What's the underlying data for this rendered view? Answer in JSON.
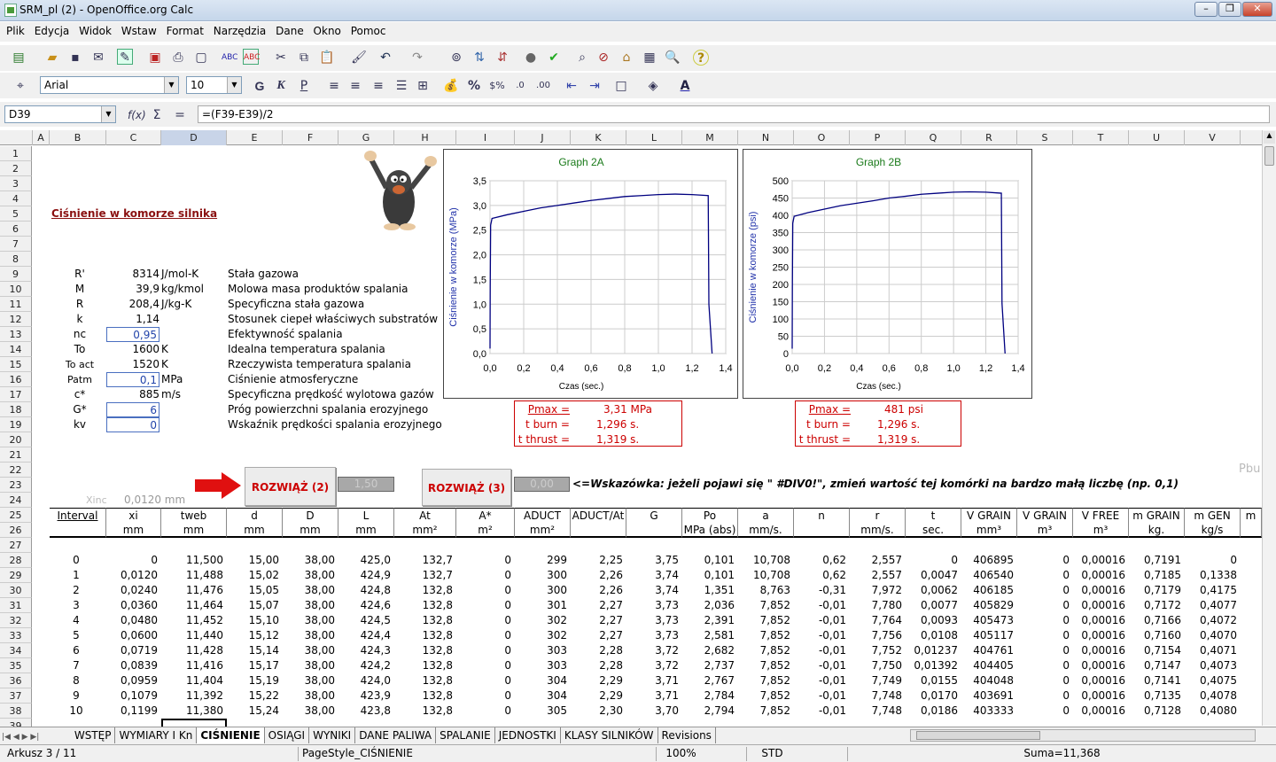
{
  "window": {
    "title": "SRM_pl (2) - OpenOffice.org Calc"
  },
  "menu": [
    "Plik",
    "Edycja",
    "Widok",
    "Wstaw",
    "Format",
    "Narzędzia",
    "Dane",
    "Okno",
    "Pomoc"
  ],
  "font": {
    "name": "Arial",
    "size": "10"
  },
  "formula": {
    "cell_ref": "D39",
    "content": "=(F39-E39)/2"
  },
  "columns": [
    "A",
    "B",
    "C",
    "D",
    "E",
    "F",
    "G",
    "H",
    "I",
    "J",
    "K",
    "L",
    "M",
    "N",
    "O",
    "P",
    "Q",
    "R",
    "S",
    "T",
    "U",
    "V"
  ],
  "rows": [
    "1",
    "2",
    "3",
    "4",
    "5",
    "6",
    "7",
    "8",
    "9",
    "10",
    "11",
    "12",
    "13",
    "14",
    "15",
    "16",
    "17",
    "18",
    "19",
    "20",
    "21",
    "22",
    "23",
    "24",
    "25",
    "26",
    "27",
    "28",
    "29",
    "30",
    "31",
    "32",
    "33",
    "34",
    "35",
    "36",
    "37",
    "38",
    "39"
  ],
  "sheet_title": "Ciśnienie w komorze silnika",
  "params": [
    {
      "sym": "R'",
      "val": "8314",
      "unit": "J/mol-K",
      "desc": "Stała gazowa"
    },
    {
      "sym": "M",
      "val": "39,9",
      "unit": "kg/kmol",
      "desc": "Molowa masa produktów spalania"
    },
    {
      "sym": "R",
      "val": "208,4",
      "unit": "J/kg-K",
      "desc": "Specyficzna stała gazowa"
    },
    {
      "sym": "k",
      "val": "1,14",
      "unit": "",
      "desc": "Stosunek ciepeł właściwych substratów"
    },
    {
      "sym": "nc",
      "val": "0,95",
      "unit": "",
      "desc": "Efektywność spalania"
    },
    {
      "sym": "To",
      "val": "1600",
      "unit": "K",
      "desc": "Idealna temperatura spalania"
    },
    {
      "sym": "To act",
      "val": "1520",
      "unit": "K",
      "desc": "Rzeczywista temperatura spalania"
    },
    {
      "sym": "Patm",
      "val": "0,1",
      "unit": "MPa",
      "desc": "Ciśnienie atmosferyczne"
    },
    {
      "sym": "c*",
      "val": "885",
      "unit": "m/s",
      "desc": "Specyficzna prędkość wylotowa gazów"
    },
    {
      "sym": "G*",
      "val": "6",
      "unit": "",
      "desc": "Próg powierzchni spalania erozyjnego"
    },
    {
      "sym": "kv",
      "val": "0",
      "unit": "",
      "desc": "Wskaźnik prędkości spalania erozyjnego"
    }
  ],
  "graph2a": {
    "title": "Graph 2A",
    "ylabel": "Ciśnienie w komorze (MPa)",
    "xlabel": "Czas (sec.)",
    "yticks": [
      "3,5",
      "3,0",
      "2,5",
      "2,0",
      "1,5",
      "1,0",
      "0,5",
      "0,0"
    ],
    "xticks": [
      "0,0",
      "0,2",
      "0,4",
      "0,6",
      "0,8",
      "1,0",
      "1,2",
      "1,4"
    ]
  },
  "graph2b": {
    "title": "Graph 2B",
    "ylabel": "Ciśnienie w komorze (psi)",
    "xlabel": "Czas (sec.)",
    "yticks": [
      "500",
      "450",
      "400",
      "350",
      "300",
      "250",
      "200",
      "150",
      "100",
      "50",
      "0"
    ],
    "xticks": [
      "0,0",
      "0,2",
      "0,4",
      "0,6",
      "0,8",
      "1,0",
      "1,2",
      "1,4"
    ]
  },
  "chart_data": [
    {
      "type": "line",
      "title": "Graph 2A",
      "xlabel": "Czas (sec.)",
      "ylabel": "Ciśnienie w komorze (MPa)",
      "xlim": [
        0,
        1.4
      ],
      "ylim": [
        0,
        3.5
      ],
      "x": [
        0,
        0.0012,
        0.0036,
        0.012,
        0.1,
        0.2,
        0.3,
        0.4,
        0.5,
        0.6,
        0.7,
        0.8,
        0.9,
        1.0,
        1.1,
        1.2,
        1.296,
        1.3,
        1.319
      ],
      "y": [
        0.101,
        1.351,
        2.6,
        2.737,
        2.81,
        2.88,
        2.95,
        3.0,
        3.05,
        3.1,
        3.14,
        3.18,
        3.2,
        3.22,
        3.23,
        3.22,
        3.2,
        1.0,
        0.0
      ]
    },
    {
      "type": "line",
      "title": "Graph 2B",
      "xlabel": "Czas (sec.)",
      "ylabel": "Ciśnienie w komorze (psi)",
      "xlim": [
        0,
        1.4
      ],
      "ylim": [
        0,
        500
      ],
      "x": [
        0,
        0.0012,
        0.0036,
        0.012,
        0.1,
        0.2,
        0.3,
        0.4,
        0.5,
        0.6,
        0.7,
        0.8,
        0.9,
        1.0,
        1.1,
        1.2,
        1.296,
        1.3,
        1.319
      ],
      "y": [
        14,
        196,
        377,
        397,
        408,
        418,
        428,
        435,
        442,
        450,
        455,
        461,
        464,
        467,
        468,
        467,
        464,
        145,
        0
      ]
    }
  ],
  "summary_a": {
    "p_lbl": "Pmax =",
    "p_val": "3,31 MPa",
    "tb_lbl": "t burn =",
    "tb_val": "1,296 s.",
    "tt_lbl": "t thrust =",
    "tt_val": "1,319 s."
  },
  "summary_b": {
    "p_lbl": "Pmax =",
    "p_val": "481 psi",
    "tb_lbl": "t burn =",
    "tb_val": "1,296 s.",
    "tt_lbl": "t thrust =",
    "tt_val": "1,319 s."
  },
  "solve2": {
    "label": "ROZWIĄŻ (2)",
    "box": "1,50"
  },
  "solve3": {
    "label": "ROZWIĄŻ (3)",
    "box": "0,00"
  },
  "hint": "<=Wskazówka: jeżeli pojawi się \" #DIV0!\", zmień wartość tej komórki na bardzo małą liczbę (np. 0,1)",
  "xinc": {
    "lbl": "Xinc",
    "val": "0,0120 mm"
  },
  "pbu": "Pbu",
  "table_headers": [
    "Interval",
    "xi",
    "tweb",
    "d",
    "D",
    "L",
    "At",
    "A*",
    "ADUCT",
    "ADUCT/At",
    "G",
    "Po",
    "a",
    "n",
    "r",
    "t",
    "V GRAIN",
    "V GRAIN",
    "V FREE",
    "m GRAIN",
    "m GEN",
    "m"
  ],
  "table_units": [
    "",
    "mm",
    "mm",
    "mm",
    "mm",
    "mm",
    "mm²",
    "m²",
    "mm²",
    "",
    "",
    "MPa (abs)",
    "mm/s.",
    "",
    "mm/s.",
    "sec.",
    "mm³",
    "m³",
    "m³",
    "kg.",
    "kg/s",
    ""
  ],
  "table_rows": [
    [
      "0",
      "0",
      "11,500",
      "15,00",
      "38,00",
      "425,0",
      "132,7",
      "0",
      "299",
      "2,25",
      "3,75",
      "0,101",
      "10,708",
      "0,62",
      "2,557",
      "0",
      "406895",
      "0",
      "0,00016",
      "0,7191",
      "0"
    ],
    [
      "1",
      "0,0120",
      "11,488",
      "15,02",
      "38,00",
      "424,9",
      "132,7",
      "0",
      "300",
      "2,26",
      "3,74",
      "0,101",
      "10,708",
      "0,62",
      "2,557",
      "0,0047",
      "406540",
      "0",
      "0,00016",
      "0,7185",
      "0,1338"
    ],
    [
      "2",
      "0,0240",
      "11,476",
      "15,05",
      "38,00",
      "424,8",
      "132,8",
      "0",
      "300",
      "2,26",
      "3,74",
      "1,351",
      "8,763",
      "-0,31",
      "7,972",
      "0,0062",
      "406185",
      "0",
      "0,00016",
      "0,7179",
      "0,4175"
    ],
    [
      "3",
      "0,0360",
      "11,464",
      "15,07",
      "38,00",
      "424,6",
      "132,8",
      "0",
      "301",
      "2,27",
      "3,73",
      "2,036",
      "7,852",
      "-0,01",
      "7,780",
      "0,0077",
      "405829",
      "0",
      "0,00016",
      "0,7172",
      "0,4077"
    ],
    [
      "4",
      "0,0480",
      "11,452",
      "15,10",
      "38,00",
      "424,5",
      "132,8",
      "0",
      "302",
      "2,27",
      "3,73",
      "2,391",
      "7,852",
      "-0,01",
      "7,764",
      "0,0093",
      "405473",
      "0",
      "0,00016",
      "0,7166",
      "0,4072"
    ],
    [
      "5",
      "0,0600",
      "11,440",
      "15,12",
      "38,00",
      "424,4",
      "132,8",
      "0",
      "302",
      "2,27",
      "3,73",
      "2,581",
      "7,852",
      "-0,01",
      "7,756",
      "0,0108",
      "405117",
      "0",
      "0,00016",
      "0,7160",
      "0,4070"
    ],
    [
      "6",
      "0,0719",
      "11,428",
      "15,14",
      "38,00",
      "424,3",
      "132,8",
      "0",
      "303",
      "2,28",
      "3,72",
      "2,682",
      "7,852",
      "-0,01",
      "7,752",
      "0,01237",
      "404761",
      "0",
      "0,00016",
      "0,7154",
      "0,4071"
    ],
    [
      "7",
      "0,0839",
      "11,416",
      "15,17",
      "38,00",
      "424,2",
      "132,8",
      "0",
      "303",
      "2,28",
      "3,72",
      "2,737",
      "7,852",
      "-0,01",
      "7,750",
      "0,01392",
      "404405",
      "0",
      "0,00016",
      "0,7147",
      "0,4073"
    ],
    [
      "8",
      "0,0959",
      "11,404",
      "15,19",
      "38,00",
      "424,0",
      "132,8",
      "0",
      "304",
      "2,29",
      "3,71",
      "2,767",
      "7,852",
      "-0,01",
      "7,749",
      "0,0155",
      "404048",
      "0",
      "0,00016",
      "0,7141",
      "0,4075"
    ],
    [
      "9",
      "0,1079",
      "11,392",
      "15,22",
      "38,00",
      "423,9",
      "132,8",
      "0",
      "304",
      "2,29",
      "3,71",
      "2,784",
      "7,852",
      "-0,01",
      "7,748",
      "0,0170",
      "403691",
      "0",
      "0,00016",
      "0,7135",
      "0,4078"
    ],
    [
      "10",
      "0,1199",
      "11,380",
      "15,24",
      "38,00",
      "423,8",
      "132,8",
      "0",
      "305",
      "2,30",
      "3,70",
      "2,794",
      "7,852",
      "-0,01",
      "7,748",
      "0,0186",
      "403333",
      "0",
      "0,00016",
      "0,7128",
      "0,4080"
    ]
  ],
  "sheet_tabs": [
    "WSTĘP",
    "WYMIARY I Kn",
    "CIŚNIENIE",
    "OSIĄGI",
    "WYNIKI",
    "DANE PALIWA",
    "SPALANIE",
    "JEDNOSTKI",
    "KLASY SILNIKÓW",
    "Revisions"
  ],
  "status": {
    "sheet": "Arkusz 3 / 11",
    "style": "PageStyle_CIŚNIENIE",
    "zoom": "100%",
    "mode": "STD",
    "sum": "Suma=11,368"
  }
}
